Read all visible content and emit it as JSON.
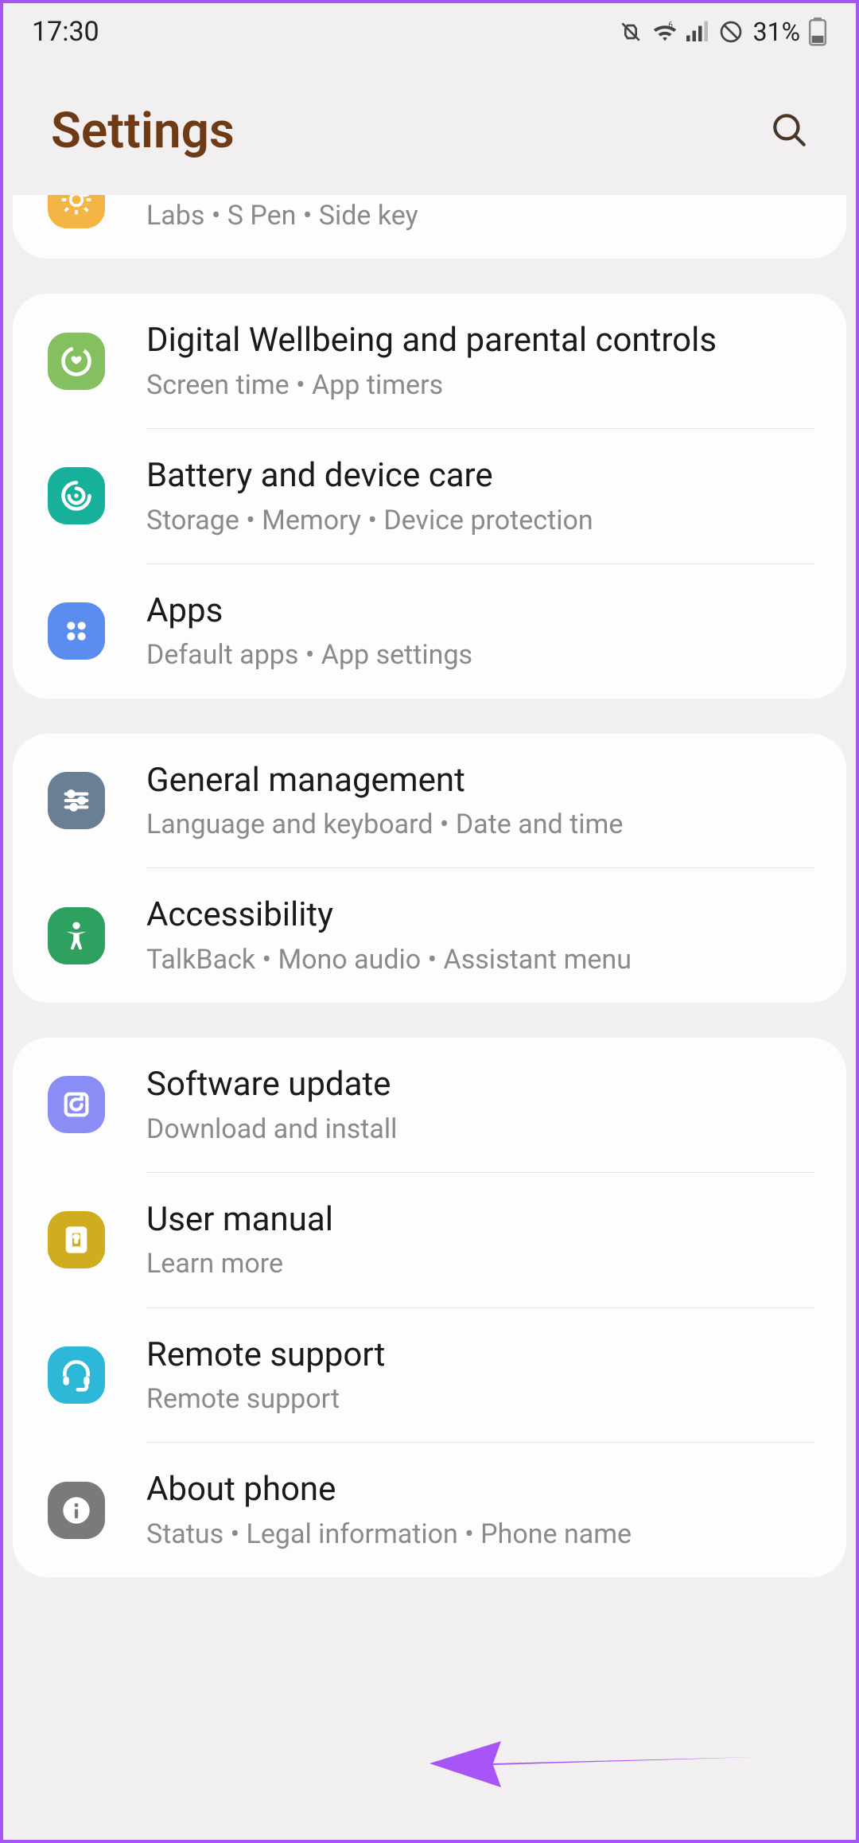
{
  "status": {
    "time": "17:30",
    "battery_pct": "31%"
  },
  "header": {
    "title": "Settings"
  },
  "groups": [
    {
      "id": "g0",
      "partial_top": true,
      "items": [
        {
          "id": "advanced",
          "title": "",
          "sub": "Labs  •  S Pen  •  Side key",
          "icon_bg": "#f5b544",
          "icon": "cog-badge"
        }
      ]
    },
    {
      "id": "g1",
      "items": [
        {
          "id": "wellbeing",
          "title": "Digital Wellbeing and parental controls",
          "sub": "Screen time  •  App timers",
          "icon_bg": "#84c060",
          "icon": "wellbeing"
        },
        {
          "id": "device-care",
          "title": "Battery and device care",
          "sub": "Storage  •  Memory  •  Device protection",
          "icon_bg": "#17b09a",
          "icon": "device-care"
        },
        {
          "id": "apps",
          "title": "Apps",
          "sub": "Default apps  •  App settings",
          "icon_bg": "#5b8df0",
          "icon": "apps"
        }
      ]
    },
    {
      "id": "g2",
      "items": [
        {
          "id": "general",
          "title": "General management",
          "sub": "Language and keyboard  •  Date and time",
          "icon_bg": "#6a7f93",
          "icon": "sliders"
        },
        {
          "id": "accessibility",
          "title": "Accessibility",
          "sub": "TalkBack  •  Mono audio  •  Assistant menu",
          "icon_bg": "#2ea060",
          "icon": "accessibility"
        }
      ]
    },
    {
      "id": "g3",
      "items": [
        {
          "id": "software-update",
          "title": "Software update",
          "sub": "Download and install",
          "icon_bg": "#8b8df6",
          "icon": "update"
        },
        {
          "id": "user-manual",
          "title": "User manual",
          "sub": "Learn more",
          "icon_bg": "#d0ad1e",
          "icon": "manual"
        },
        {
          "id": "remote-support",
          "title": "Remote support",
          "sub": "Remote support",
          "icon_bg": "#2cb8d6",
          "icon": "headset"
        },
        {
          "id": "about-phone",
          "title": "About phone",
          "sub": "Status  •  Legal information  •  Phone name",
          "icon_bg": "#7a7a7a",
          "icon": "info"
        }
      ]
    }
  ]
}
